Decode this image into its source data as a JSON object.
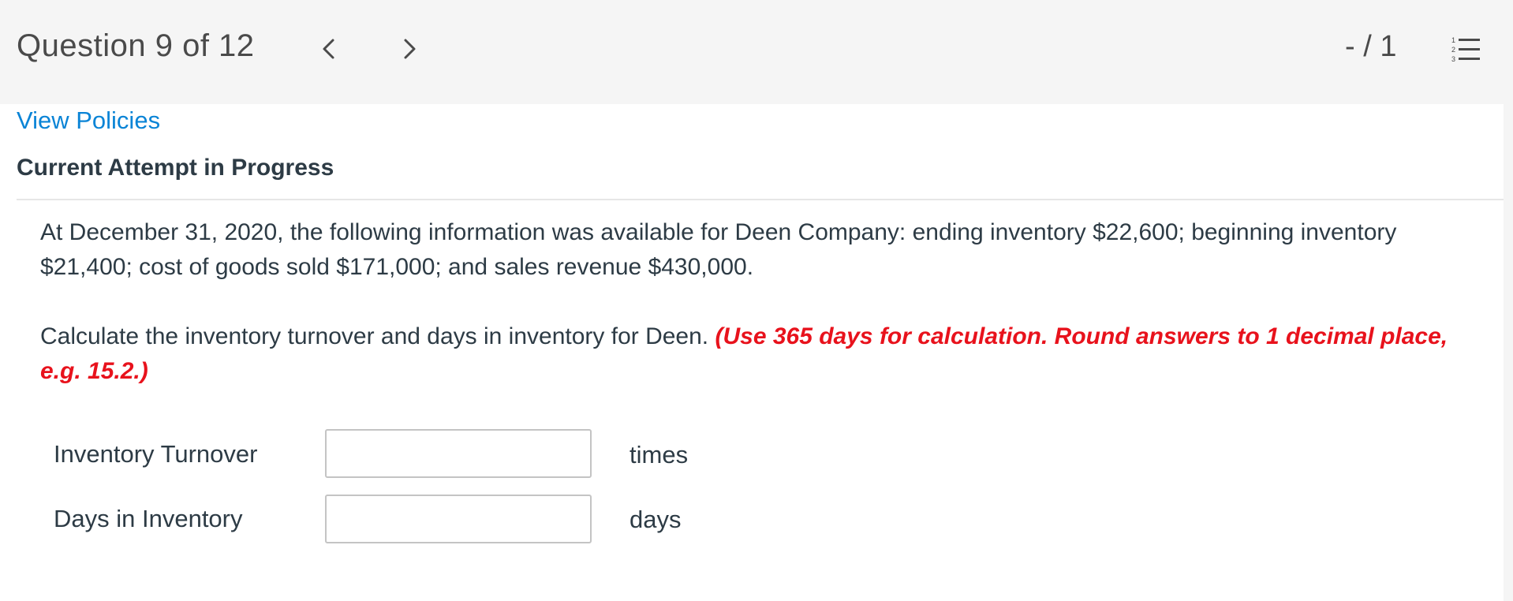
{
  "header": {
    "question_counter": "Question 9 of 12",
    "score": "- / 1",
    "prev_icon": "chevron-left-icon",
    "next_icon": "chevron-right-icon",
    "list_icon": "numbered-list-icon"
  },
  "links": {
    "view_policies": "View Policies"
  },
  "attempt": {
    "title": "Current Attempt in Progress"
  },
  "question": {
    "paragraph1": "At December 31, 2020, the following information was available for Deen Company: ending inventory $22,600; beginning inventory $21,400; cost of goods sold $171,000; and sales revenue $430,000.",
    "paragraph2_text": "Calculate the inventory turnover and days in inventory for Deen.",
    "paragraph2_hint": "(Use 365 days for calculation. Round answers to 1 decimal place, e.g. 15.2.)"
  },
  "answers": [
    {
      "label": "Inventory Turnover",
      "value": "",
      "unit": "times"
    },
    {
      "label": "Days in Inventory",
      "value": "",
      "unit": "days"
    }
  ],
  "colors": {
    "link": "#0a84d6",
    "hint": "#e8121c",
    "text": "#2d3b45",
    "background": "#f5f5f5"
  }
}
